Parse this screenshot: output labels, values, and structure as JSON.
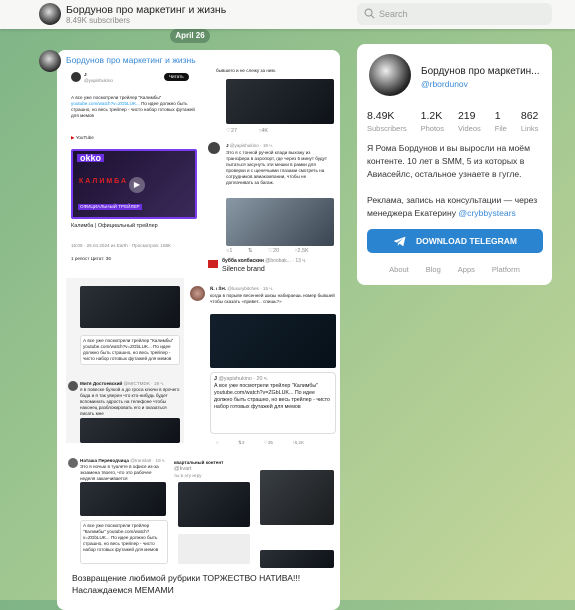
{
  "header": {
    "title": "Бордунов про маркетинг и жизнь",
    "subscribers": "8.49K subscribers",
    "search_placeholder": "Search"
  },
  "date_label": "April 26",
  "message": {
    "author": "Бордунов про маркетинг и жизнь",
    "caption_line1": "Возвращение любимой рубрики ТОРЖЕСТВО НАТИВА!!!",
    "caption_line2": "Наслаждаемся МЕМАМИ",
    "tweets": {
      "main": {
        "name": "J",
        "handle": "@yapishukino",
        "follow": "Читать",
        "text": "А все уже посмотрели трейлер \"Калимбы\"",
        "link": "youtube.com/watch?v=ZGbLUK...",
        "text2": "По идее должно быть страшно, но весь трейлер - чисто набор готовых футажей для мемов",
        "source": "YouTube",
        "video_brand": "okko",
        "video_title": "КАЛИМБА",
        "video_badge": "ОФИЦИАЛЬНЫЙ ТРЕЙЛЕР",
        "card_title": "Калимба | Официальный трейлер",
        "meta": "15:05 · 25.04.2024 из Earth · Просмотров: 168K",
        "reposts": "1 репост  Цитат: 36"
      },
      "top_right": {
        "text": "бывшего и не слежу за ним.",
        "stats": [
          "1",
          "",
          "27",
          "4K"
        ]
      },
      "j_reply": {
        "name": "J",
        "handle": "@yapishukino · 19 ч.",
        "text": "Это я с тонной ручной клади выхожу из трансфера в аэропорт, где через 5 минут будут пытаться засунуть эти мешки в рамки для проверки и с щенячьими глазами смотреть на сотрудников авиакомпании, чтобы не доплачивать за багаж.",
        "stats": [
          "1",
          "",
          "20",
          "2,5K"
        ]
      },
      "bubba": {
        "name": "бубба колбаскин",
        "handle": "@boobak... · 13 ч.",
        "text": "Silence brand"
      },
      "luxury": {
        "name": "Ñ. ı ŠH.",
        "handle": "@luxurybitches · 15 ч.",
        "text": "когда в порыве весенней шизы набираешь номер бывшей чтобы сказать «привет... спишь?»",
        "quote_name": "J",
        "quote_handle": "@yapishukino · 20 ч.",
        "quote_text": "А все уже посмотрели трейлер \"Калимбы\" youtube.com/watch?v=ZGbLUK... По идее должно быть страшно, но весь трейлер - чисто набор готовых футажей для мемов",
        "stats": [
          "",
          "3",
          "35",
          "6,2K"
        ]
      },
      "mitya": {
        "name": "Митя Достоевский",
        "handle": "@MrCTMDK · 19 ч.",
        "text": "я в повеске булкой а до гроса ключи в ярочего бада и я так уверен что кто-нибудь будет вспоминать эдрость на телефоне чтобы наконец разблокировать его и оказаться писать мне"
      },
      "natasha": {
        "name": "Наташа Переводчица",
        "handle": "@translatr · 19 ч.",
        "text": "Это я ночью в туалете в офисе из-за экзамена твоего, что это рабочее неделя заканчивается"
      },
      "kvartal": {
        "name": "квартальный контент",
        "handle": "@kvart",
        "text": "ты в эту игру"
      }
    }
  },
  "profile": {
    "title": "Бордунов про маркетин...",
    "handle": "@rbordunov",
    "stats": [
      {
        "value": "8.49K",
        "label": "Subscribers"
      },
      {
        "value": "1.2K",
        "label": "Photos"
      },
      {
        "value": "219",
        "label": "Videos"
      },
      {
        "value": "1",
        "label": "File"
      },
      {
        "value": "862",
        "label": "Links"
      }
    ],
    "desc1": "Я Рома Бордунов и вы выросли на моём контенте. 10 лет в SMM, 5 из которых в Авиасейлс, остальное узнаете в гугле.",
    "desc2": "Реклама, запись на консультации — через менеджера Екатерину ",
    "desc_link": "@crybbystears",
    "download": "DOWNLOAD TELEGRAM",
    "footer": [
      "About",
      "Blog",
      "Apps",
      "Platform"
    ]
  },
  "colors": {
    "accent": "#2a84d0",
    "link": "#3a8ad6"
  }
}
